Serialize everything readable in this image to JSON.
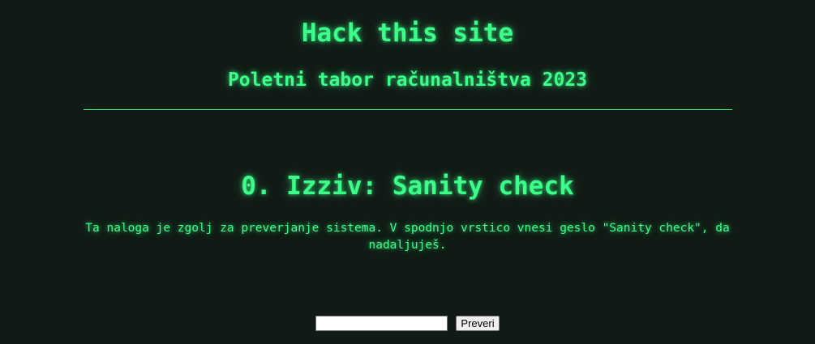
{
  "header": {
    "title": "Hack this site",
    "subtitle": "Poletni tabor računalništva 2023"
  },
  "challenge": {
    "title": "0. Izziv: Sanity check",
    "description": "Ta naloga je zgolj za preverjanje sistema. V spodnjo vrstico vnesi geslo \"Sanity check\", da nadaljuješ."
  },
  "form": {
    "input_value": "",
    "submit_label": "Preveri"
  },
  "colors": {
    "background": "#121a16",
    "accent": "#3cff8a"
  }
}
